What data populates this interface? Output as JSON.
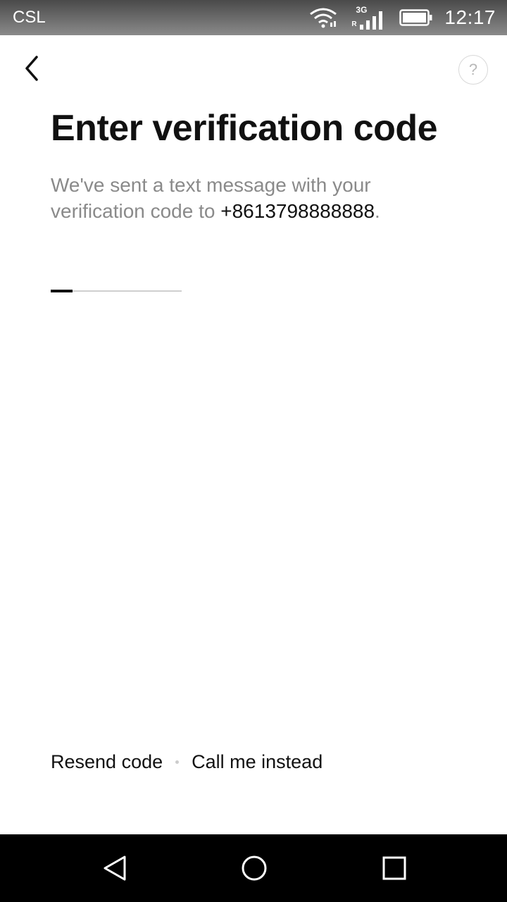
{
  "status_bar": {
    "carrier": "CSL",
    "network_type": "3G",
    "roaming_indicator": "R",
    "time": "12:17",
    "icons": [
      "wifi-icon",
      "signal-icon",
      "battery-icon"
    ]
  },
  "header": {
    "back_icon": "chevron-left-icon",
    "help_label": "?"
  },
  "main": {
    "title": "Enter verification code",
    "description_prefix": "We've sent a text message with your verification code to ",
    "phone_number": "+8613798888888",
    "description_suffix": ".",
    "code_value": ""
  },
  "footer": {
    "resend_label": "Resend code",
    "call_label": "Call me instead"
  },
  "nav_bar": {
    "icons": [
      "back-triangle-icon",
      "home-circle-icon",
      "recents-square-icon"
    ]
  },
  "colors": {
    "title": "#111111",
    "description": "#8a8a8a",
    "underline": "#cfcfcf",
    "nav_background": "#000000"
  }
}
